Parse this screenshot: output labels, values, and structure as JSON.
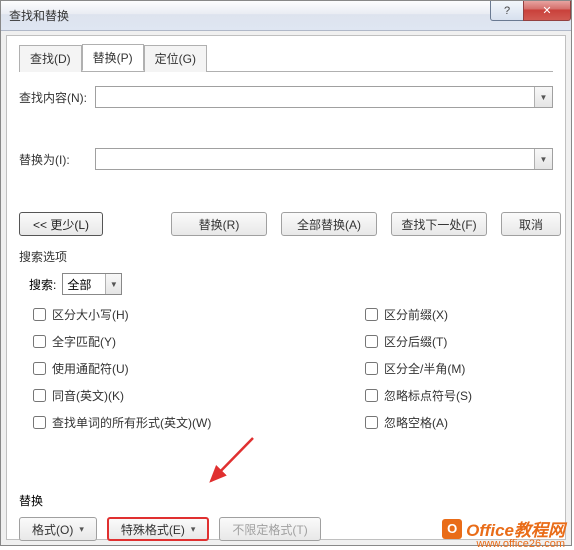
{
  "window": {
    "title": "查找和替换",
    "help_icon": "?",
    "close_icon": "✕"
  },
  "tabs": {
    "find": "查找(D)",
    "replace": "替换(P)",
    "goto": "定位(G)"
  },
  "fields": {
    "find_label": "查找内容(N):",
    "find_value": "",
    "replace_label": "替换为(I):",
    "replace_value": ""
  },
  "buttons": {
    "less": "<< 更少(L)",
    "replace": "替换(R)",
    "replace_all": "全部替换(A)",
    "find_next": "查找下一处(F)",
    "cancel": "取消"
  },
  "search_options": {
    "heading": "搜索选项",
    "search_label": "搜索:",
    "search_value": "全部",
    "left": {
      "match_case": "区分大小写(H)",
      "whole_word": "全字匹配(Y)",
      "wildcards": "使用通配符(U)",
      "sounds_like": "同音(英文)(K)",
      "all_forms": "查找单词的所有形式(英文)(W)"
    },
    "right": {
      "prefix": "区分前缀(X)",
      "suffix": "区分后缀(T)",
      "full_half": "区分全/半角(M)",
      "ignore_punct": "忽略标点符号(S)",
      "ignore_space": "忽略空格(A)"
    }
  },
  "replace_section": {
    "heading": "替换",
    "format": "格式(O)",
    "special": "特殊格式(E)",
    "no_formatting": "不限定格式(T)"
  },
  "watermark": {
    "brand": "Office教程网",
    "url": "www.office26.com",
    "logo_letter": "O"
  }
}
